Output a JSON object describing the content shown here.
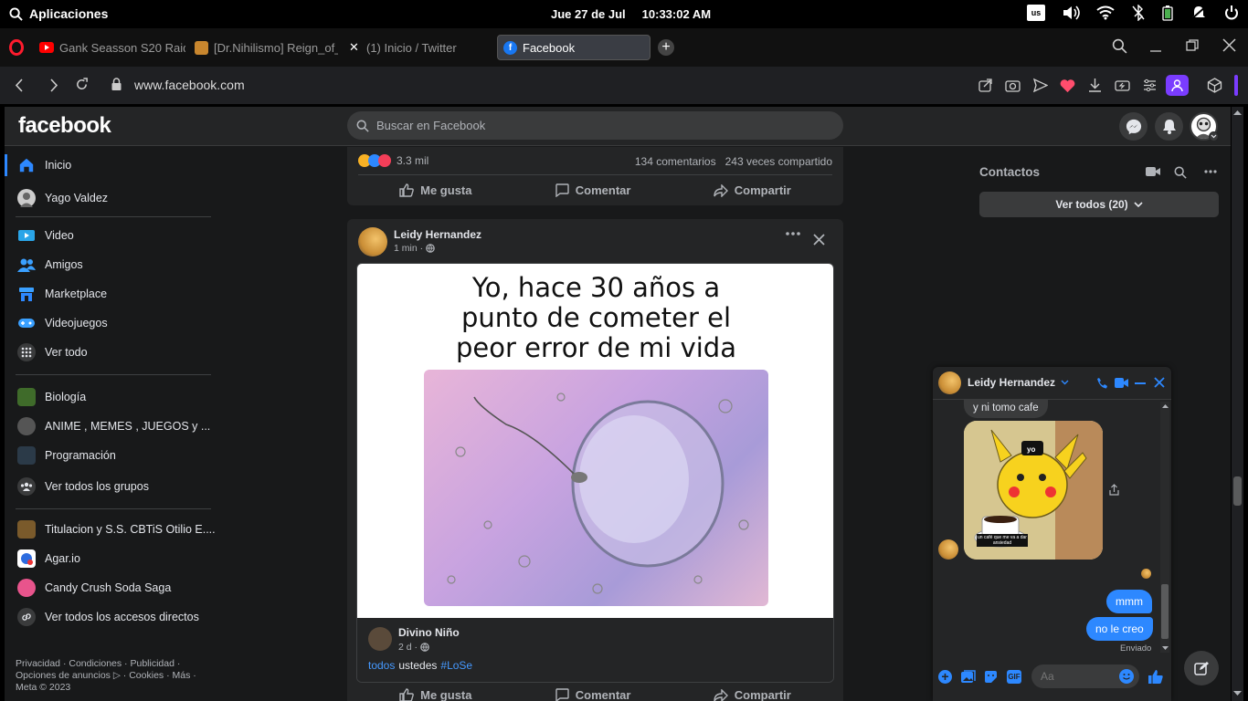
{
  "os": {
    "apps_label": "Aplicaciones",
    "date": "Jue 27 de Jul",
    "time": "10:33:02 AM",
    "keyboard_layout": "us"
  },
  "browser": {
    "tabs": [
      {
        "title": "Gank Seasson S20 Raide",
        "favicon": "youtube-icon",
        "color": "#ff0000"
      },
      {
        "title": "[Dr.Nihilismo] Reign_of_f",
        "favicon": "page-icon",
        "color": "#c8862e"
      },
      {
        "title": "(1) Inicio / Twitter",
        "favicon": "x-icon",
        "color": "#ffffff"
      },
      {
        "title": "Facebook",
        "favicon": "facebook-icon",
        "color": "#1877f2"
      }
    ],
    "url": "www.facebook.com"
  },
  "facebook": {
    "logo": "facebook",
    "search_placeholder": "Buscar en Facebook",
    "nav": [
      {
        "label": "Inicio",
        "icon": "home-icon"
      },
      {
        "label": "Yago Valdez",
        "icon": "avatar"
      },
      {
        "label": "Video",
        "icon": "video-icon"
      },
      {
        "label": "Amigos",
        "icon": "friends-icon"
      },
      {
        "label": "Marketplace",
        "icon": "marketplace-icon"
      },
      {
        "label": "Videojuegos",
        "icon": "gaming-icon"
      },
      {
        "label": "Ver todo",
        "icon": "grid-icon"
      },
      {
        "label": "Biología",
        "icon": "group-avatar"
      },
      {
        "label": "ANIME , MEMES , JUEGOS y ...",
        "icon": "group-avatar"
      },
      {
        "label": "Programación",
        "icon": "group-avatar"
      },
      {
        "label": "Ver todos los grupos",
        "icon": "groups-icon"
      },
      {
        "label": "Titulacion y S.S. CBTiS Otilio E....",
        "icon": "group-avatar"
      },
      {
        "label": "Agar.io",
        "icon": "game-avatar"
      },
      {
        "label": "Candy Crush Soda Saga",
        "icon": "game-avatar"
      },
      {
        "label": "Ver todos los accesos directos",
        "icon": "link-icon"
      }
    ],
    "footer": {
      "line1": "Privacidad · Condiciones · Publicidad ·",
      "line2": "Opciones de anuncios ▷ · Cookies · Más ·",
      "line3": "Meta © 2023"
    },
    "prev_post": {
      "reactions": "3.3 mil",
      "comments": "134 comentarios",
      "shares": "243 veces compartido",
      "like": "Me gusta",
      "comment": "Comentar",
      "share": "Compartir"
    },
    "post": {
      "author": "Leidy Hernandez",
      "time": "1 min ·",
      "meme_text": [
        "Yo, hace 30 años a",
        "punto de cometer el",
        "peor error de mi vida"
      ],
      "shared_author": "Divino Niño",
      "shared_time": "2 d ·",
      "caption_tag": "todos",
      "caption_text": "ustedes",
      "caption_hashtag": "#LoSe",
      "like": "Me gusta",
      "comment": "Comentar",
      "share": "Compartir"
    },
    "contacts": {
      "title": "Contactos",
      "see_all": "Ver todos (20)"
    },
    "chat": {
      "name": "Leidy Hernandez",
      "messages": {
        "incoming_text": "y ni tomo cafe",
        "sticker_label": "yo",
        "sticker_caption": "un café que me va a dar ansiedad",
        "outgoing_1": "mmm",
        "outgoing_2": "no le creo",
        "status": "Enviado"
      },
      "input_placeholder": "Aa"
    }
  }
}
